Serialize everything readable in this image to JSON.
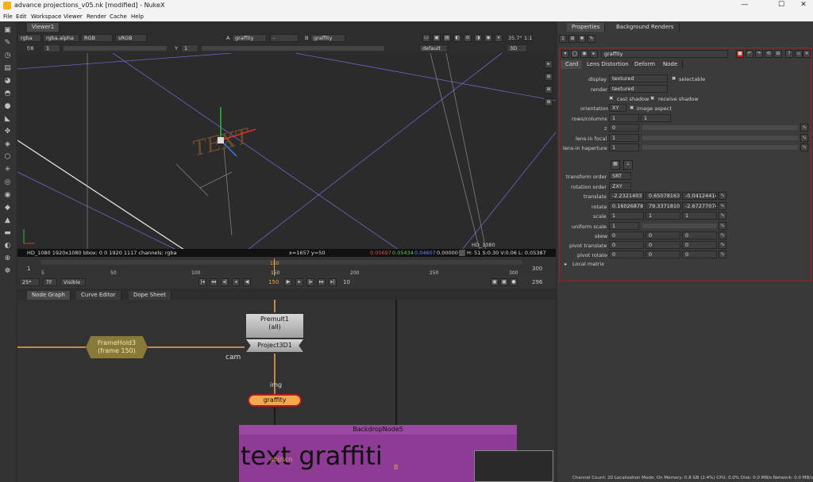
{
  "window": {
    "title": "advance projections_v05.nk [modified] - NukeX",
    "minimize": "—",
    "maximize": "☐",
    "close": "✕"
  },
  "menu": [
    "File",
    "Edit",
    "Workspace",
    "Viewer",
    "Render",
    "Cache",
    "Help"
  ],
  "viewer": {
    "tab": "Viewer1",
    "channels": "rgba",
    "alpha": "rgba.alpha",
    "display": "RGB",
    "lut": "sRGB",
    "input_a": "graffity",
    "a_label": "A",
    "a_value": "-",
    "b_label": "B",
    "input_b": "graffity",
    "zoom": "35.7°",
    "ratio": "1:1",
    "fstop": "f/8",
    "frame_field": "1",
    "y_label": "Y",
    "y_field": "1",
    "gain_label": "default",
    "view_mode": "3D",
    "overlay_text": "TEXT",
    "format_tr": "HD_1080",
    "info": "HD_1080 1920x1080  bbox: 0 0 1920 1117 channels: rgba",
    "coords": "x=1657 y=50",
    "pix_r": "0.05697",
    "pix_g": "0.05434",
    "pix_b": "0.04607",
    "pix_a": "0.00000",
    "hsvl": "H: 51 S:0.30 V:0.06  L: 0.05387"
  },
  "timeline": {
    "ticks": [
      "5",
      "50",
      "100",
      "150",
      "200",
      "250",
      "300"
    ],
    "start": "1",
    "end": "300",
    "current": "150",
    "fps": "25*",
    "tf": "TF",
    "visible": "Visible",
    "frame_display": "150",
    "step": "10",
    "end_frame": "296"
  },
  "graph_tabs": [
    "Node Graph",
    "Curve Editor",
    "Dope Sheet"
  ],
  "nodes": {
    "premult": "Premult1\n(all)",
    "project": "Project3D1",
    "framehold": "FrameHold3\n(frame 150)",
    "graffity": "graffity",
    "backdrop_title": "BackdropNode5",
    "backdrop_text": "text graffiti",
    "cam_label": "cam",
    "img_label": "img",
    "objscn_label": "obj/scn",
    "b_label": "B"
  },
  "properties": {
    "tabs": [
      "Properties",
      "Background Renders"
    ],
    "node_name": "graffity",
    "subtabs": [
      "Card",
      "Lens Distortion",
      "Deform",
      "Node"
    ],
    "display_label": "display",
    "display_value": "textured",
    "selectable": "selectable",
    "render_label": "render",
    "render_value": "textured",
    "cast_shadow": "cast shadow",
    "receive_shadow": "receive shadow",
    "orientation_label": "orientation",
    "orientation_value": "XY",
    "image_aspect": "image aspect",
    "rows_label": "rows/columns",
    "rows": "1",
    "cols": "1",
    "z_label": "z",
    "z": "0",
    "lens_focal_label": "lens-in focal",
    "lens_focal": "1",
    "lens_hap_label": "lens-in haperture",
    "lens_hap": "1",
    "transform_order_label": "transform order",
    "transform_order": "SRT",
    "rotation_order_label": "rotation order",
    "rotation_order": "ZXY",
    "translate_label": "translate",
    "translate": [
      "-2.2321403",
      "0.65078163",
      "-0.04124414"
    ],
    "rotate_label": "rotate",
    "rotate": [
      "0.16026878",
      "79.3371810!",
      "-2.67277074"
    ],
    "scale_label": "scale",
    "scale": [
      "1",
      "1",
      "1"
    ],
    "uniform_label": "uniform scale",
    "uniform": "1",
    "skew_label": "skew",
    "skew": [
      "0",
      "0",
      "0"
    ],
    "pivot_t_label": "pivot translate",
    "pivot_t": [
      "0",
      "0",
      "0"
    ],
    "pivot_r_label": "pivot rotate",
    "pivot_r": [
      "0",
      "0",
      "0"
    ],
    "local_matrix": "Local matrix"
  },
  "status": "Channel Count: 20  Localization Mode: On  Memory: 0.8 GB (2.4%)  CPU: 0.0%  Disk: 0.0 MB/s  Network: 0.0 MB/s",
  "colors": {
    "accent": "#f5a03a",
    "node_orange": "#f5a84c",
    "backdrop": "#8d3b95",
    "framehold": "#8a7a3a",
    "prop_border": "#a02020"
  }
}
